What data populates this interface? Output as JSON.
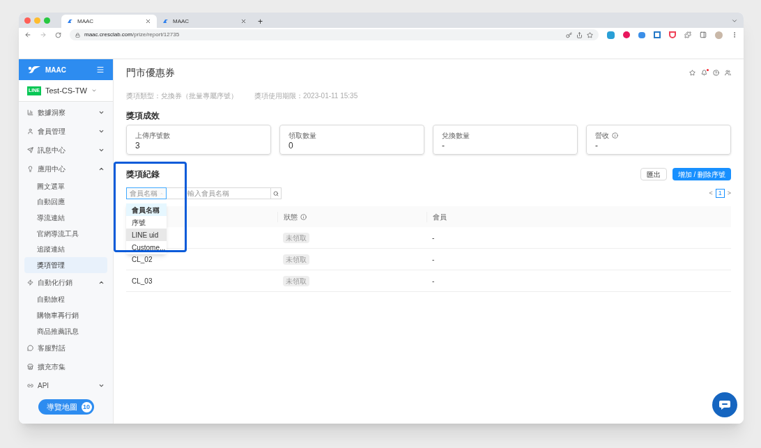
{
  "browser": {
    "tabs": [
      {
        "title": "MAAC",
        "selected": true
      },
      {
        "title": "MAAC",
        "selected": false
      }
    ],
    "new_tab": "+",
    "url": {
      "host": "maac.cresclab.com",
      "path": "/prize/report/12735"
    }
  },
  "sidebar": {
    "brand": "MAAC",
    "account": {
      "badge": "LINE",
      "name": "Test-CS-TW"
    },
    "items": [
      {
        "kind": "group",
        "label": "數據洞察",
        "expanded": false
      },
      {
        "kind": "group",
        "label": "會員管理",
        "expanded": false
      },
      {
        "kind": "group",
        "label": "訊息中心",
        "expanded": false
      },
      {
        "kind": "group",
        "label": "應用中心",
        "expanded": true,
        "children": [
          {
            "label": "圖文選單",
            "selected": false
          },
          {
            "label": "自動回應",
            "selected": false
          },
          {
            "label": "導流連結",
            "selected": false
          },
          {
            "label": "官網導流工具",
            "selected": false
          },
          {
            "label": "追蹤連結",
            "selected": false
          },
          {
            "label": "獎項管理",
            "selected": true
          }
        ]
      },
      {
        "kind": "group",
        "label": "自動化行銷",
        "expanded": true,
        "children": [
          {
            "label": "自動旅程",
            "selected": false
          },
          {
            "label": "購物車再行銷",
            "selected": false
          },
          {
            "label": "商品推薦訊息",
            "selected": false
          }
        ]
      },
      {
        "kind": "link",
        "label": "客服對話"
      },
      {
        "kind": "link",
        "label": "擴充市集"
      },
      {
        "kind": "group",
        "label": "API",
        "expanded": false
      }
    ],
    "tour_button": {
      "label": "導覽地圖",
      "count": "10"
    }
  },
  "header": {
    "notifications_unread": true
  },
  "page": {
    "title": "門市優惠券",
    "meta": [
      "獎項類型：兌換券（批量專屬序號）",
      "獎項使用期限：2023-01-11 15:35"
    ],
    "stats_title": "獎項成效",
    "stats": [
      {
        "label": "上傳序號數",
        "value": "3",
        "info": false
      },
      {
        "label": "領取數量",
        "value": "0",
        "info": false
      },
      {
        "label": "兌換數量",
        "value": "-",
        "info": false
      },
      {
        "label": "營收",
        "value": "-",
        "info": true
      }
    ],
    "records": {
      "title": "獎項紀錄",
      "highlighted": true,
      "export_button": "匯出",
      "add_button": "增加 / 刪除序號",
      "search": {
        "filter": "會員名稱",
        "placeholder": "輸入會員名稱",
        "menu_open": true,
        "options": [
          {
            "label": "會員名稱",
            "selected": true,
            "hovered": false
          },
          {
            "label": "序號",
            "selected": false,
            "hovered": false
          },
          {
            "label": "LINE uid",
            "selected": false,
            "hovered": true
          },
          {
            "label": "Custome...",
            "selected": false,
            "hovered": false
          }
        ]
      },
      "pagination": {
        "prev": "<",
        "next": ">",
        "pages": [
          {
            "label": "1",
            "selected": true
          }
        ]
      },
      "table": {
        "columns": [
          {
            "label": "狀態",
            "info": true
          },
          {
            "label": "會員",
            "info": false
          }
        ],
        "rows": [
          {
            "status": "未領取",
            "member": "-"
          },
          {
            "serial": "CL_02",
            "status": "未領取",
            "member": "-"
          },
          {
            "serial": "CL_03",
            "status": "未領取",
            "member": "-"
          }
        ]
      }
    }
  }
}
